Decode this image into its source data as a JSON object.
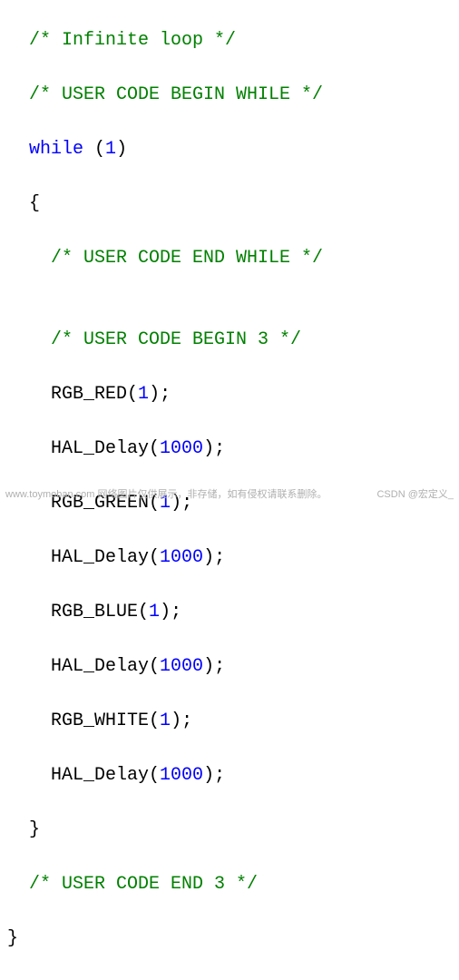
{
  "code": {
    "line1_a": "  /* Infinite loop */",
    "line2": "  /* USER CODE BEGIN WHILE */",
    "line3_kw": "while",
    "line3_punct1": " (",
    "line3_num": "1",
    "line3_punct2": ")",
    "line4": "  {",
    "line5": "    /* USER CODE END WHILE */",
    "blank": "",
    "line7": "    /* USER CODE BEGIN 3 */",
    "l8_fn": "    RGB_RED",
    "l8_p1": "(",
    "l8_n": "1",
    "l8_p2": ");",
    "l9_fn": "    HAL_Delay",
    "l9_p1": "(",
    "l9_n": "1000",
    "l9_p2": ");",
    "l10_fn": "    RGB_GREEN",
    "l10_p1": "(",
    "l10_n": "1",
    "l10_p2": ");",
    "l11_fn": "    HAL_Delay",
    "l11_p1": "(",
    "l11_n": "1000",
    "l11_p2": ");",
    "l12_fn": "    RGB_BLUE",
    "l12_p1": "(",
    "l12_n": "1",
    "l12_p2": ");",
    "l13_fn": "    HAL_Delay",
    "l13_p1": "(",
    "l13_n": "1000",
    "l13_p2": ");",
    "l14_fn": "    RGB_WHITE",
    "l14_p1": "(",
    "l14_n": "1",
    "l14_p2": ");",
    "l15_fn": "    HAL_Delay",
    "l15_p1": "(",
    "l15_n": "1000",
    "l15_p2": ");",
    "line16": "  }",
    "line17": "  /* USER CODE END 3 */",
    "line18": "}"
  },
  "watermark": {
    "left_site": "www.toymoban.com",
    "left_text": "  网络图片仅供展示，非存储，如有侵权请联系删除。",
    "right": "CSDN @宏定义_"
  }
}
